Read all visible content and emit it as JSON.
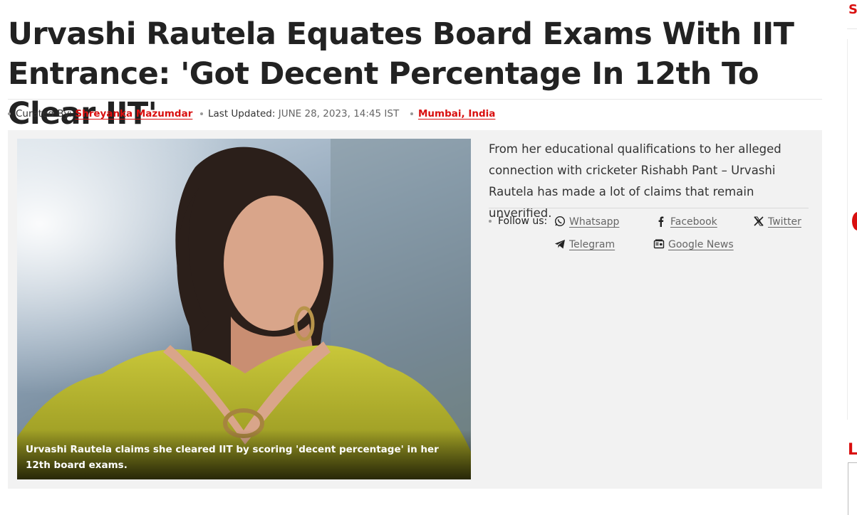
{
  "article": {
    "headline": "Urvashi Rautela Equates Board Exams With IIT Entrance: 'Got Decent Percentage In 12th To Clear IIT'",
    "meta": {
      "curated_label": "Curated By:",
      "curator": "Shreyanka Mazumdar",
      "updated_label": "Last Updated:",
      "updated_value": "JUNE 28, 2023, 14:45 IST",
      "location": "Mumbai, India"
    },
    "image_caption": "Urvashi Rautela claims she cleared IIT by scoring 'decent percentage' in her 12th board exams.",
    "summary": "From her educational qualifications to her alleged connection with cricketer Rishabh Pant – Urvashi Rautela has made a lot of claims that remain unverified.",
    "follow": {
      "label": "Follow us:",
      "links": [
        {
          "label": "Whatsapp",
          "icon": "whatsapp-icon"
        },
        {
          "label": "Facebook",
          "icon": "facebook-icon"
        },
        {
          "label": "Twitter",
          "icon": "x-twitter-icon"
        },
        {
          "label": "Telegram",
          "icon": "telegram-icon"
        },
        {
          "label": "Google News",
          "icon": "google-news-icon"
        }
      ]
    }
  },
  "sidebar": {
    "top_letter": "S",
    "bottom_letter": "L"
  },
  "colors": {
    "accent": "#d90f0f",
    "panel": "#f2f2f2",
    "text": "#222222"
  }
}
